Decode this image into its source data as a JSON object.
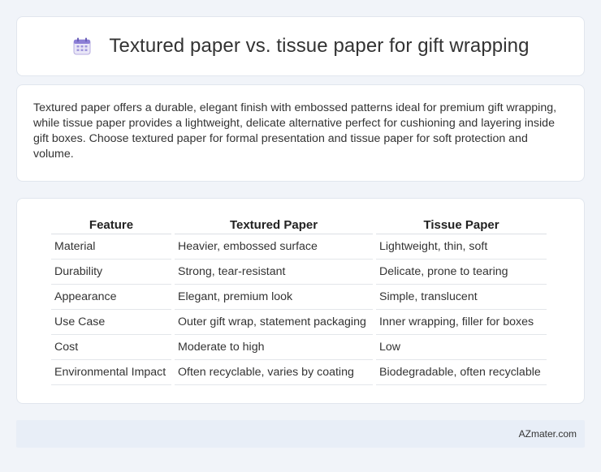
{
  "header": {
    "title": "Textured paper vs. tissue paper for gift wrapping",
    "icon": "calendar-icon"
  },
  "summary": {
    "text": "Textured paper offers a durable, elegant finish with embossed patterns ideal for premium gift wrapping, while tissue paper provides a lightweight, delicate alternative perfect for cushioning and layering inside gift boxes. Choose textured paper for formal presentation and tissue paper for soft protection and volume."
  },
  "table": {
    "headers": [
      "Feature",
      "Textured Paper",
      "Tissue Paper"
    ],
    "rows": [
      [
        "Material",
        "Heavier, embossed surface",
        "Lightweight, thin, soft"
      ],
      [
        "Durability",
        "Strong, tear-resistant",
        "Delicate, prone to tearing"
      ],
      [
        "Appearance",
        "Elegant, premium look",
        "Simple, translucent"
      ],
      [
        "Use Case",
        "Outer gift wrap, statement packaging",
        "Inner wrapping, filler for boxes"
      ],
      [
        "Cost",
        "Moderate to high",
        "Low"
      ],
      [
        "Environmental Impact",
        "Often recyclable, varies by coating",
        "Biodegradable, often recyclable"
      ]
    ]
  },
  "footer": {
    "brand": "AZmater.com"
  }
}
